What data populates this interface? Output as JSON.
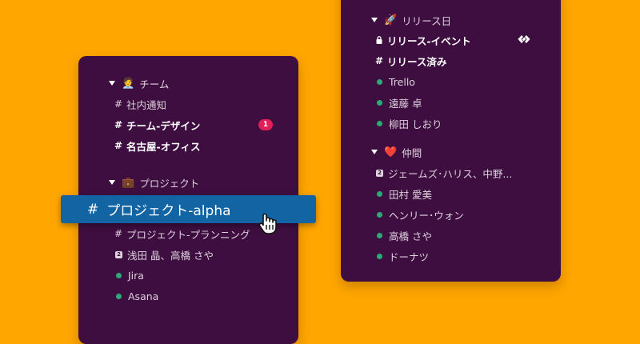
{
  "left_panel": {
    "team_section": {
      "label": "チーム",
      "emoji": "🧑‍💼"
    },
    "team_channels": [
      {
        "label": "社内通知"
      },
      {
        "label": "チーム-デザイン",
        "badge": "1"
      },
      {
        "label": "名古屋-オフィス"
      }
    ],
    "project_section": {
      "label": "プロジェクト",
      "emoji": "💼"
    },
    "selected_channel": "プロジェクト-alpha",
    "project_items": {
      "channel_planning": "プロジェクト-プランニング",
      "dm_group": {
        "count": "2",
        "label": "浅田 晶、高橋 さや"
      },
      "app_jira": "Jira",
      "app_asana": "Asana"
    }
  },
  "right_panel": {
    "release_section": {
      "label": "リリース日",
      "emoji": "🚀"
    },
    "release_items": {
      "private_channel": "リリース-イベント",
      "channel_released": "リリース済み",
      "app_trello": "Trello",
      "dm_1": "遠藤 卓",
      "dm_2": "柳田 しおり"
    },
    "friends_section": {
      "label": "仲間",
      "emoji": "❤️"
    },
    "friends_items": {
      "dm_group": {
        "count": "2",
        "label": "ジェームズ･ハリス、中野..."
      },
      "dm_1": "田村 愛美",
      "dm_2": "ヘンリー･ウォン",
      "dm_3": "高橋 さや",
      "dm_4": "ドーナツ"
    }
  },
  "icons": {
    "caret": "caret-down-icon",
    "hash": "#",
    "lock": "lock-icon",
    "presence": "presence-dot-icon",
    "shared_link": "shared-channel-icon",
    "cursor": "hand-pointer-icon"
  },
  "colors": {
    "background": "#ffa600",
    "sidebar": "#3f0e40",
    "selected": "#1264a3",
    "badge": "#e01e5a",
    "presence": "#2bac76"
  }
}
